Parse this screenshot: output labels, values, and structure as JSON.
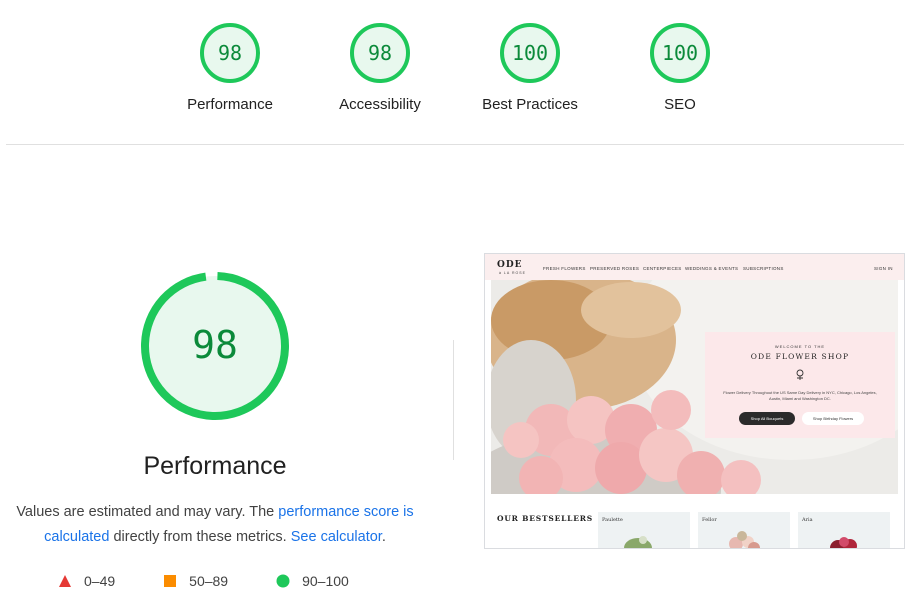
{
  "scores": [
    {
      "label": "Performance",
      "score": "98"
    },
    {
      "label": "Accessibility",
      "score": "98"
    },
    {
      "label": "Best Practices",
      "score": "100"
    },
    {
      "label": "SEO",
      "score": "100"
    }
  ],
  "main": {
    "score": "98",
    "title": "Performance",
    "desc_prefix": "Values are estimated and may vary. The ",
    "link1": "performance score is calculated",
    "desc_mid": " directly from these metrics. ",
    "link2": "See calculator",
    "desc_suffix": "."
  },
  "legend": [
    {
      "shape": "triangle",
      "color": "#e53935",
      "range": "0–49"
    },
    {
      "shape": "square",
      "color": "#fb8c00",
      "range": "50–89"
    },
    {
      "shape": "circle",
      "color": "#1ec85a",
      "range": "90–100"
    }
  ],
  "colors": {
    "pass": "#1ec85a",
    "pass_fill": "#e8f8ee",
    "pass_text": "#0b8a3a",
    "link": "#1a73e8"
  },
  "screenshot": {
    "logo": "ODE",
    "logo_sub": "à LA ROSE",
    "nav": [
      "FRESH FLOWERS",
      "PRESERVED ROSES",
      "CENTERPIECES",
      "WEDDINGS & EVENTS",
      "SUBSCRIPTIONS"
    ],
    "signin": "SIGN IN",
    "welcome": "WELCOME TO THE",
    "shop_name": "ODE FLOWER SHOP",
    "promo_text": "Flower Delivery Throughout the US Same Day Delivery in NYC, Chicago, Los Angeles, Austin, Miami and Washington DC.",
    "btn_bouquets": "Shop All Bouquets",
    "btn_birthday": "Shop Birthday Flowers",
    "bestsellers": "OUR BESTSELLERS",
    "cards": [
      "Paulette",
      "Fellor",
      "Aria"
    ]
  }
}
